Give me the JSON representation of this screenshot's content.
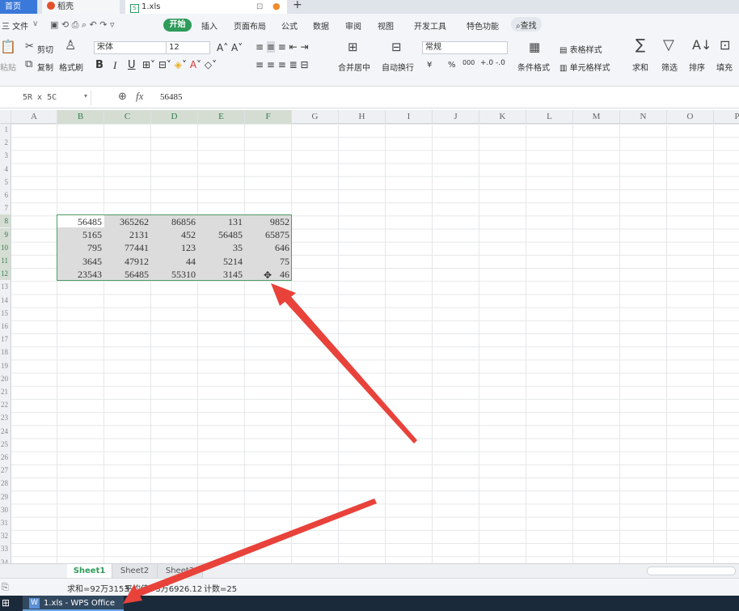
{
  "tabs": [
    {
      "label": "首页"
    },
    {
      "label": "稻壳"
    },
    {
      "label": "1.xls"
    }
  ],
  "tab_new": "+",
  "menu": {
    "file": "三 文件",
    "items": [
      "开始",
      "插入",
      "页面布局",
      "公式",
      "数据",
      "审阅",
      "视图",
      "开发工具",
      "特色功能"
    ],
    "search": "查找"
  },
  "toolbar": {
    "cut": "剪切",
    "paste": "粘贴",
    "copy": "复制",
    "format_painter": "格式刷",
    "font_name": "宋体",
    "font_size": "12",
    "merge_center": "合并居中",
    "wrap_text": "自动换行",
    "number_format": "常规",
    "conditional_format": "条件格式",
    "table_style": "表格样式",
    "cell_style": "单元格样式",
    "sum": "求和",
    "filter": "筛选",
    "sort": "排序",
    "fill": "填充",
    "bold": "B",
    "italic": "I",
    "underline": "U",
    "currency": "¥",
    "percent": "%",
    "thousands": "000"
  },
  "formula": {
    "name_box": "5R x 5C",
    "fx": "fx",
    "value": "56485"
  },
  "columns": [
    "A",
    "B",
    "C",
    "D",
    "E",
    "F",
    "G",
    "H",
    "I",
    "J",
    "K",
    "L",
    "M",
    "N",
    "O",
    "P"
  ],
  "rows": [
    "1",
    "2",
    "3",
    "4",
    "5",
    "6",
    "7",
    "8",
    "9",
    "10",
    "11",
    "12",
    "13",
    "14",
    "15",
    "16",
    "17",
    "18",
    "19",
    "20",
    "21",
    "22",
    "23",
    "24",
    "25",
    "26",
    "27",
    "28",
    "29",
    "30",
    "31",
    "32",
    "33",
    "34"
  ],
  "table": [
    [
      "56485",
      "365262",
      "86856",
      "131",
      "9852"
    ],
    [
      "5165",
      "2131",
      "452",
      "56485",
      "65875"
    ],
    [
      "795",
      "77441",
      "123",
      "35",
      "646"
    ],
    [
      "3645",
      "47912",
      "44",
      "5214",
      "75"
    ],
    [
      "23543",
      "56485",
      "55310",
      "3145",
      "46"
    ]
  ],
  "sheets": [
    "Sheet1",
    "Sheet2",
    "Sheet3"
  ],
  "status": {
    "sum": "求和=92万3153",
    "avg": "平均值=3万6926.12",
    "count": "计数=25"
  },
  "taskbar": {
    "app": "1.xls - WPS Office"
  },
  "annotation_color": "#e8423a",
  "accent": "#2f9b5b"
}
